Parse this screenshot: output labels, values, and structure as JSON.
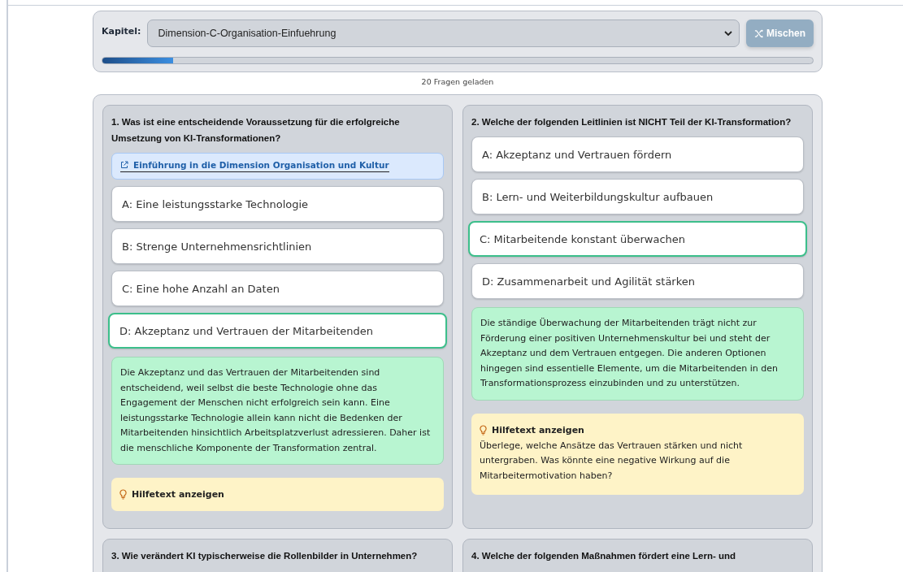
{
  "chapter": {
    "label": "Kapitel:",
    "value": "Dimension-C-Organisation-Einfuehrung"
  },
  "shuffle": {
    "label": "Mischen",
    "disabled": true
  },
  "progress": {
    "level": 0.1
  },
  "status": "20 Fragen geladen",
  "questions": [
    {
      "title": "1. Was ist eine entscheidende Voraussetzung für die erfolgreiche Umsetzung von KI-Transformationen?",
      "link": "Einführung in die Dimension Organisation und Kultur",
      "options": [
        {
          "letter": "A:",
          "text": "Eine leistungsstarke Technologie",
          "selected": false
        },
        {
          "letter": "B:",
          "text": "Strenge Unternehmensrichtlinien",
          "selected": false
        },
        {
          "letter": "C:",
          "text": "Eine hohe Anzahl an Daten",
          "selected": false
        },
        {
          "letter": "D:",
          "text": "Akzeptanz und Vertrauen der Mitarbeitenden",
          "selected": true
        }
      ],
      "explanation": "Die Akzeptanz und das Vertrauen der Mitarbeitenden sind entscheidend, weil selbst die beste Technologie ohne das Engagement der Menschen nicht erfolgreich sein kann. Eine leistungsstarke Technologie allein kann nicht die Bedenken der Mitarbeitenden hinsichtlich Arbeitsplatzverlust adressieren. Daher ist die menschliche Komponente der Transformation zentral.",
      "hint": {
        "label": "Hilfetext anzeigen"
      }
    },
    {
      "title": "2. Welche der folgenden Leitlinien ist NICHT Teil der KI-Transformation?",
      "options": [
        {
          "letter": "A:",
          "text": "Akzeptanz und Vertrauen fördern",
          "selected": false
        },
        {
          "letter": "B:",
          "text": "Lern- und Weiterbildungskultur aufbauen",
          "selected": false
        },
        {
          "letter": "C:",
          "text": "Mitarbeitende konstant überwachen",
          "selected": true
        },
        {
          "letter": "D:",
          "text": "Zusammenarbeit und Agilität stärken",
          "selected": false
        }
      ],
      "explanation": "Die ständige Überwachung der Mitarbeitenden trägt nicht zur Förderung einer positiven Unternehmenskultur bei und steht der Akzeptanz und dem Vertrauen entgegen. Die anderen Optionen hingegen sind essentielle Elemente, um die Mitarbeitenden in den Transformationsprozess einzubinden und zu unterstützen.",
      "hint": {
        "label": "Hilfetext anzeigen",
        "text": "Überlege, welche Ansätze das Vertrauen stärken und nicht untergraben. Was könnte eine negative Wirkung auf die Mitarbeitermotivation haben?"
      }
    },
    {
      "title": "3. Wie verändert KI typischerweise die Rollenbilder in Unternehmen?"
    },
    {
      "title": "4. Welche der folgenden Maßnahmen fördert eine Lern- und"
    }
  ]
}
